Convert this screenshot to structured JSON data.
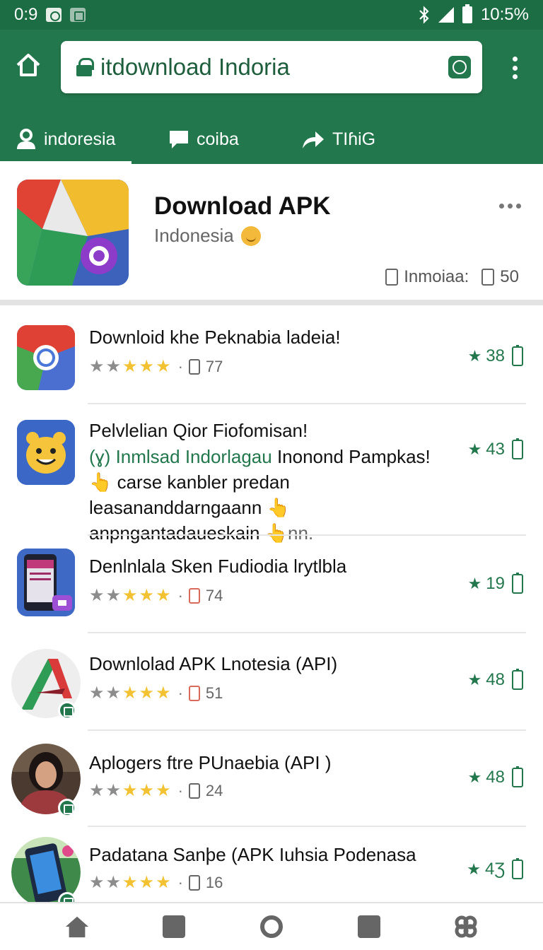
{
  "status_bar": {
    "time_left": "0:9",
    "time_right": "10:5%"
  },
  "browser": {
    "url": "itdownload Indoria",
    "tabs": [
      {
        "label": "indoresia",
        "icon": "person-icon",
        "active": true
      },
      {
        "label": "coiba",
        "icon": "chat-icon",
        "active": false
      },
      {
        "label": "TIɦiG",
        "icon": "share-icon",
        "active": false
      }
    ]
  },
  "header": {
    "title": "Download APK",
    "subtitle": "Indonesia",
    "meta_label": "Inmoiaa:",
    "meta_count": "50"
  },
  "apps": [
    {
      "name": "Downloid khe Peknabia ladeia!",
      "downloads": "77",
      "score": "38",
      "rating": 3
    },
    {
      "name": "Pelvlelian Qior Fiofomisan!",
      "desc_green": "(ɣ) Inmlsad Indorlagau",
      "desc_rest": " Inonond Pampkas! 👆 carse kanbler predan leasananddarngaann 👆 anpngantadaueskain 👆",
      "desc_tail": "nn.",
      "score": "43"
    },
    {
      "name": "Denlnlala Sken Fudiodia lrytlbla",
      "downloads": "74",
      "score": "19",
      "rating": 3
    },
    {
      "name": "Downlolad APK Lnotesia (API)",
      "downloads": "51",
      "score": "48",
      "rating": 3
    },
    {
      "name": "Aplogers ftre PUnaebia (API )",
      "downloads": "24",
      "score": "48",
      "rating": 3
    },
    {
      "name": "Padatana Sanþe (APK Iuhsia Podenasa",
      "downloads": "16",
      "score": "4Ʒ",
      "rating": 3
    }
  ],
  "colors": {
    "brand": "#23774c",
    "star": "#f2c232"
  }
}
